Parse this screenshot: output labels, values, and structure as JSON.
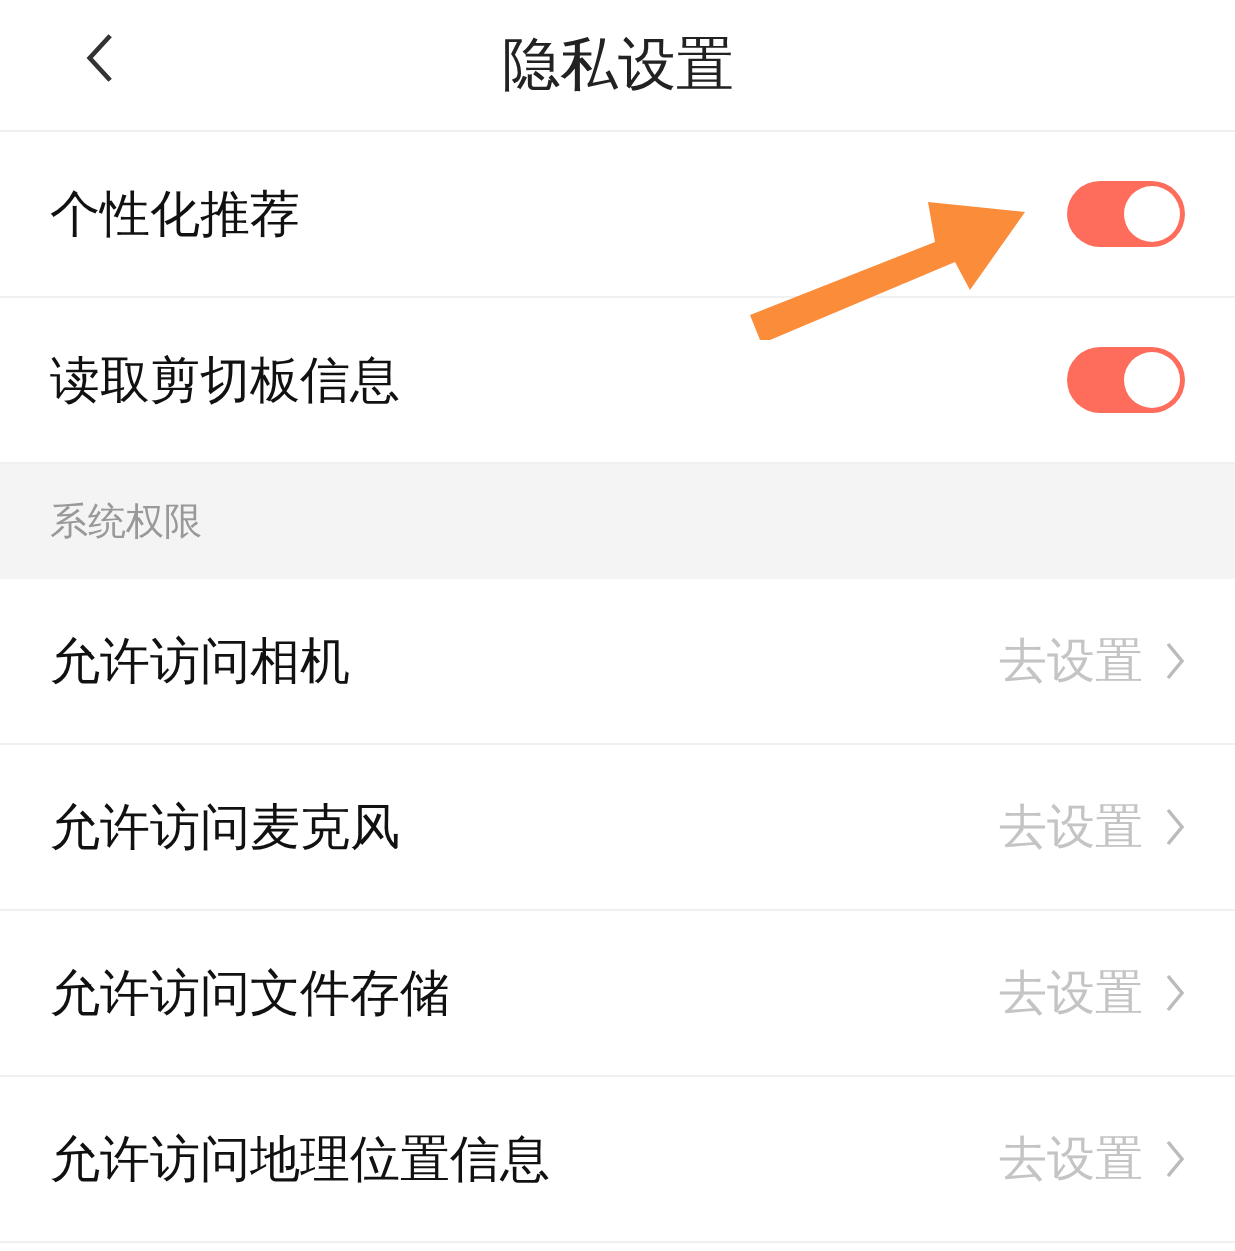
{
  "header": {
    "title": "隐私设置"
  },
  "toggles": [
    {
      "label": "个性化推荐",
      "on": true
    },
    {
      "label": "读取剪切板信息",
      "on": true
    }
  ],
  "section": {
    "title": "系统权限"
  },
  "permissions": [
    {
      "label": "允许访问相机",
      "action": "去设置"
    },
    {
      "label": "允许访问麦克风",
      "action": "去设置"
    },
    {
      "label": "允许访问文件存储",
      "action": "去设置"
    },
    {
      "label": "允许访问地理位置信息",
      "action": "去设置"
    }
  ]
}
